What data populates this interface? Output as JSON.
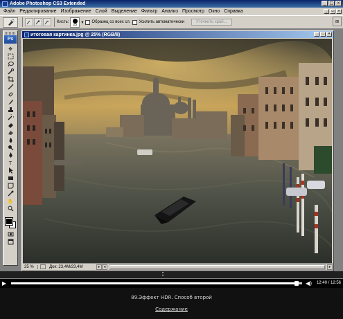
{
  "titlebar": {
    "title": "Adobe Photoshop CS3 Extended",
    "buttons": [
      "_",
      "□",
      "×"
    ]
  },
  "menu": {
    "items": [
      "Файл",
      "Редактирование",
      "Изображение",
      "Слой",
      "Выделение",
      "Фильтр",
      "Анализ",
      "Просмотр",
      "Окно",
      "Справка"
    ]
  },
  "options": {
    "brush_label": "Кисть:",
    "brush_size": "25",
    "sample_all_layers": "Образец со всех сл.",
    "auto_enhance": "Усилить автоматически",
    "refine_edge": "Уточнить край..."
  },
  "toolbox": {
    "logo": "Ps"
  },
  "document": {
    "title": "итоговая картинка.jpg @ 25% (RGB/8)",
    "zoom": "25 %",
    "doc_info": "Док: 23,4M/23,4M",
    "watermark": ""
  },
  "player": {
    "time": "12:40 / 12:56",
    "progress": 0.98,
    "play_symbol": "▶",
    "volume_symbol": "◀)"
  },
  "caption": "89.Эффект HDR. Способ второй",
  "contents_link": "Содержание",
  "colors": {
    "title_bar": "#0a246a",
    "chrome": "#d4d0c8",
    "player_bg": "#000000"
  }
}
